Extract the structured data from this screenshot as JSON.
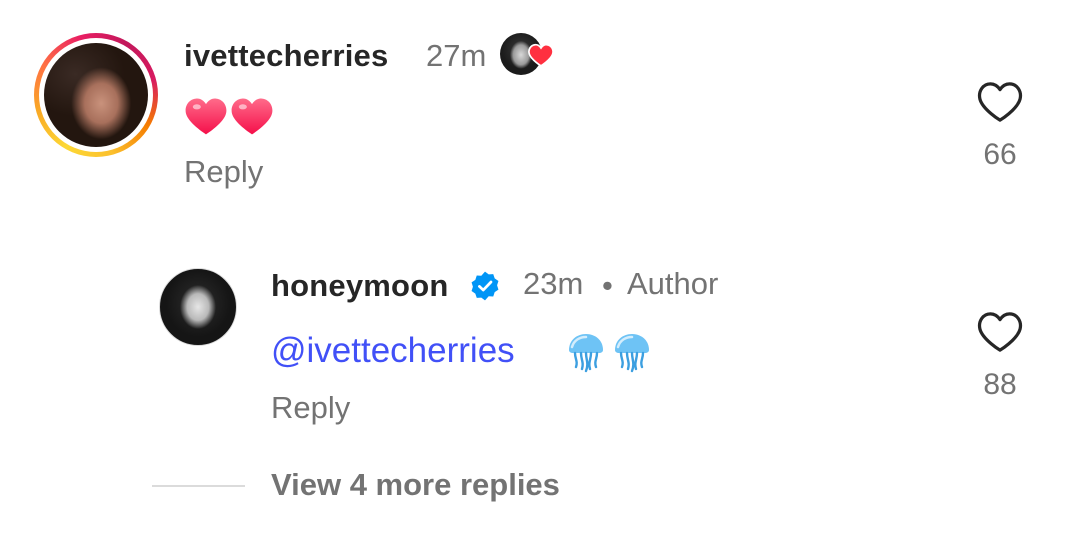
{
  "comments": [
    {
      "username": "ivettecherries",
      "time": "27m",
      "text": "❤️❤️",
      "reply_label": "Reply",
      "like_count": "66",
      "liked_by_creator": true
    }
  ],
  "reply": {
    "username": "honeymoon",
    "verified": true,
    "time": "23m",
    "separator": "•",
    "author_label": "Author",
    "mention": "@ivettecherries",
    "emoji": "🪼🪼",
    "reply_label": "Reply",
    "like_count": "88"
  },
  "thread": {
    "view_more_label": "View 4 more replies"
  },
  "colors": {
    "text_primary": "#262626",
    "text_secondary": "#737373",
    "mention": "#4150f7",
    "verified": "#0095f6",
    "like_heart": "#ff3040"
  },
  "icons": {
    "like": "heart-outline-icon",
    "creator_like": "heart-filled-icon",
    "verified": "verified-badge-icon"
  }
}
